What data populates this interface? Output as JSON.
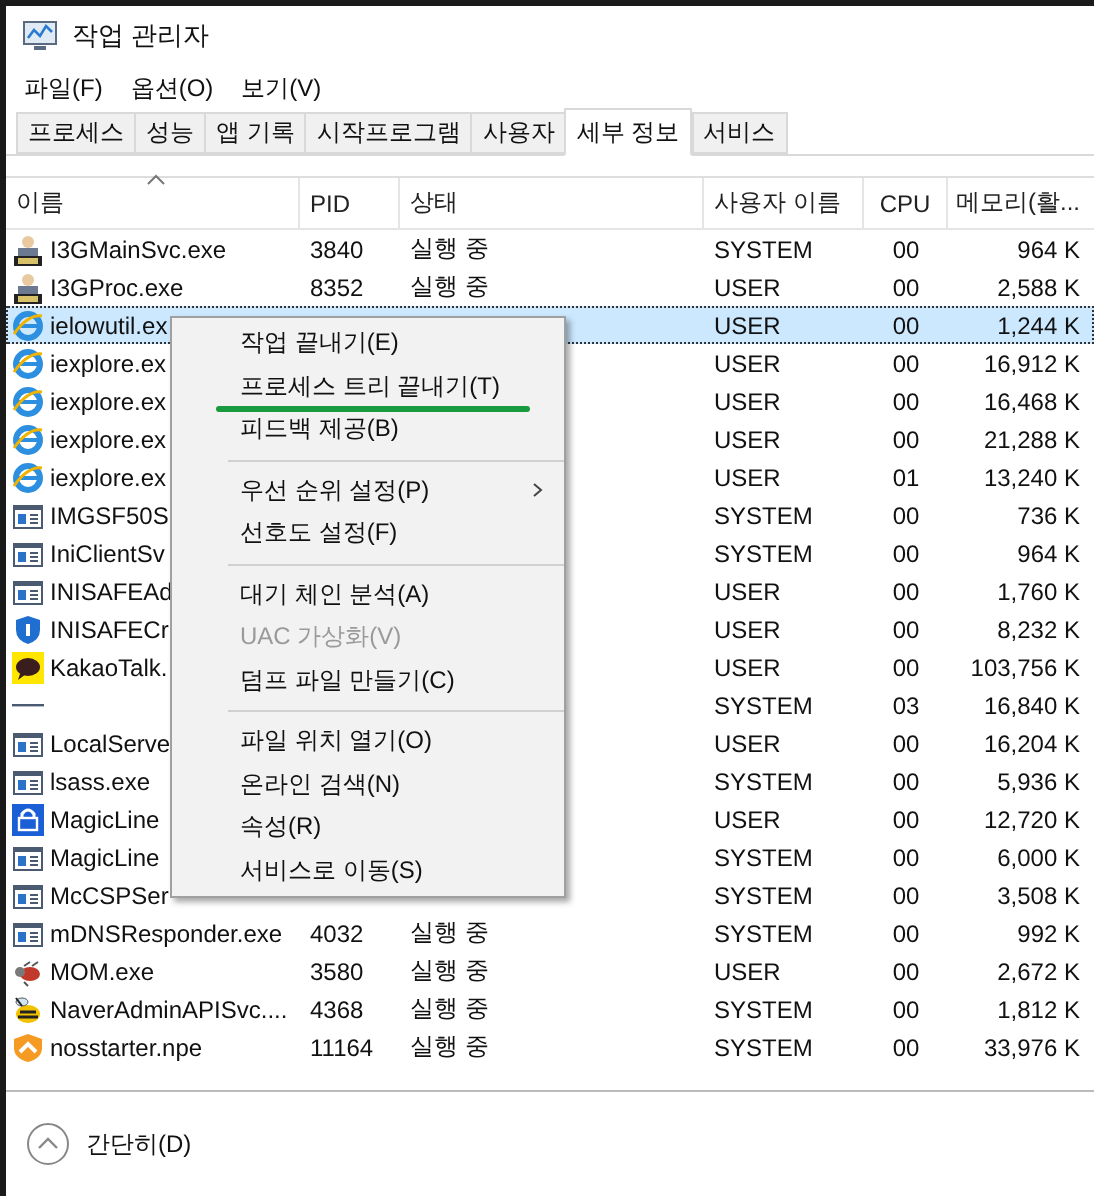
{
  "window": {
    "title": "작업 관리자"
  },
  "menu_bar": [
    "파일(F)",
    "옵션(O)",
    "보기(V)"
  ],
  "tabs": [
    {
      "label": "프로세스",
      "selected": false
    },
    {
      "label": "성능",
      "selected": false
    },
    {
      "label": "앱 기록",
      "selected": false
    },
    {
      "label": "시작프로그램",
      "selected": false
    },
    {
      "label": "사용자",
      "selected": false
    },
    {
      "label": "세부 정보",
      "selected": true
    },
    {
      "label": "서비스",
      "selected": false
    }
  ],
  "table": {
    "columns": [
      "이름",
      "PID",
      "상태",
      "사용자 이름",
      "CPU",
      "메모리(활..."
    ],
    "rows": [
      {
        "kind": "badge",
        "name": "I3GMainSvc.exe",
        "pid": "3840",
        "status": "실행 중",
        "user": "SYSTEM",
        "cpu": "00",
        "memory": "964 K",
        "selected": false
      },
      {
        "kind": "badge",
        "name": "I3GProc.exe",
        "pid": "8352",
        "status": "실행 중",
        "user": "USER",
        "cpu": "00",
        "memory": "2,588 K",
        "selected": false
      },
      {
        "kind": "globe",
        "name": "ielowutil.ex",
        "user": "USER",
        "cpu": "00",
        "memory": "1,244 K",
        "selected": true
      },
      {
        "kind": "globe",
        "name": "iexplore.ex",
        "user": "USER",
        "cpu": "00",
        "memory": "16,912 K",
        "selected": false
      },
      {
        "kind": "globe",
        "name": "iexplore.ex",
        "user": "USER",
        "cpu": "00",
        "memory": "16,468 K",
        "selected": false
      },
      {
        "kind": "globe",
        "name": "iexplore.ex",
        "user": "USER",
        "cpu": "00",
        "memory": "21,288 K",
        "selected": false
      },
      {
        "kind": "globe",
        "name": "iexplore.ex",
        "user": "USER",
        "cpu": "01",
        "memory": "13,240 K",
        "selected": false
      },
      {
        "kind": "window",
        "name": "IMGSF50S",
        "user": "SYSTEM",
        "cpu": "00",
        "memory": "736 K",
        "selected": false
      },
      {
        "kind": "window",
        "name": "IniClientSv",
        "user": "SYSTEM",
        "cpu": "00",
        "memory": "964 K",
        "selected": false
      },
      {
        "kind": "window",
        "name": "INISAFEAd",
        "user": "USER",
        "cpu": "00",
        "memory": "1,760 K",
        "selected": false
      },
      {
        "kind": "shield",
        "name": "INISAFECr",
        "user": "USER",
        "cpu": "00",
        "memory": "8,232 K",
        "selected": false
      },
      {
        "kind": "chat",
        "name": "KakaoTalk.",
        "user": "USER",
        "cpu": "00",
        "memory": "103,756 K",
        "selected": false
      },
      {
        "kind": "dash",
        "user": "SYSTEM",
        "cpu": "03",
        "memory": "16,840 K",
        "selected": false
      },
      {
        "kind": "window",
        "name": "LocalServe",
        "user": "USER",
        "cpu": "00",
        "memory": "16,204 K",
        "selected": false
      },
      {
        "kind": "window",
        "name": "lsass.exe",
        "user": "SYSTEM",
        "cpu": "00",
        "memory": "5,936 K",
        "selected": false
      },
      {
        "kind": "lock",
        "name": "MagicLine",
        "user": "USER",
        "cpu": "00",
        "memory": "12,720 K",
        "selected": false
      },
      {
        "kind": "window",
        "name": "MagicLine",
        "user": "SYSTEM",
        "cpu": "00",
        "memory": "6,000 K",
        "selected": false
      },
      {
        "kind": "window",
        "name": "McCSPSer",
        "user": "SYSTEM",
        "cpu": "00",
        "memory": "3,508 K",
        "selected": false
      },
      {
        "kind": "window",
        "name": "mDNSResponder.exe",
        "pid": "4032",
        "status": "실행 중",
        "user": "SYSTEM",
        "cpu": "00",
        "memory": "992 K",
        "selected": false
      },
      {
        "kind": "bug",
        "name": "MOM.exe",
        "pid": "3580",
        "status": "실행 중",
        "user": "USER",
        "cpu": "00",
        "memory": "2,672 K",
        "selected": false
      },
      {
        "kind": "bee",
        "name": "NaverAdminAPISvc....",
        "pid": "4368",
        "status": "실행 중",
        "user": "SYSTEM",
        "cpu": "00",
        "memory": "1,812 K",
        "selected": false
      },
      {
        "kind": "orange",
        "name": "nosstarter.npe",
        "pid": "11164",
        "status": "실행 중",
        "user": "SYSTEM",
        "cpu": "00",
        "memory": "33,976 K",
        "selected": false
      }
    ]
  },
  "context_menu": [
    {
      "kind": "item",
      "label": "작업 끝내기(E)",
      "disabled": false,
      "submenu": false,
      "underlined": false
    },
    {
      "kind": "item",
      "label": "프로세스 트리 끝내기(T)",
      "disabled": false,
      "submenu": false,
      "underlined": true
    },
    {
      "kind": "item",
      "label": "피드백 제공(B)",
      "disabled": false,
      "submenu": false,
      "underlined": false
    },
    {
      "kind": "separator"
    },
    {
      "kind": "item",
      "label": "우선 순위 설정(P)",
      "disabled": false,
      "submenu": true,
      "underlined": false
    },
    {
      "kind": "item",
      "label": "선호도 설정(F)",
      "disabled": false,
      "submenu": false,
      "underlined": false
    },
    {
      "kind": "separator"
    },
    {
      "kind": "item",
      "label": "대기 체인 분석(A)",
      "disabled": false,
      "submenu": false,
      "underlined": false
    },
    {
      "kind": "item",
      "label": "UAC 가상화(V)",
      "disabled": true,
      "submenu": false,
      "underlined": false
    },
    {
      "kind": "item",
      "label": "덤프 파일 만들기(C)",
      "disabled": false,
      "submenu": false,
      "underlined": false
    },
    {
      "kind": "separator"
    },
    {
      "kind": "item",
      "label": "파일 위치 열기(O)",
      "disabled": false,
      "submenu": false,
      "underlined": false
    },
    {
      "kind": "item",
      "label": "온라인 검색(N)",
      "disabled": false,
      "submenu": false,
      "underlined": false
    },
    {
      "kind": "item",
      "label": "속성(R)",
      "disabled": false,
      "submenu": false,
      "underlined": false
    },
    {
      "kind": "item",
      "label": "서비스로 이동(S)",
      "disabled": false,
      "submenu": false,
      "underlined": false
    }
  ],
  "footer": {
    "label": "간단히(D)"
  }
}
